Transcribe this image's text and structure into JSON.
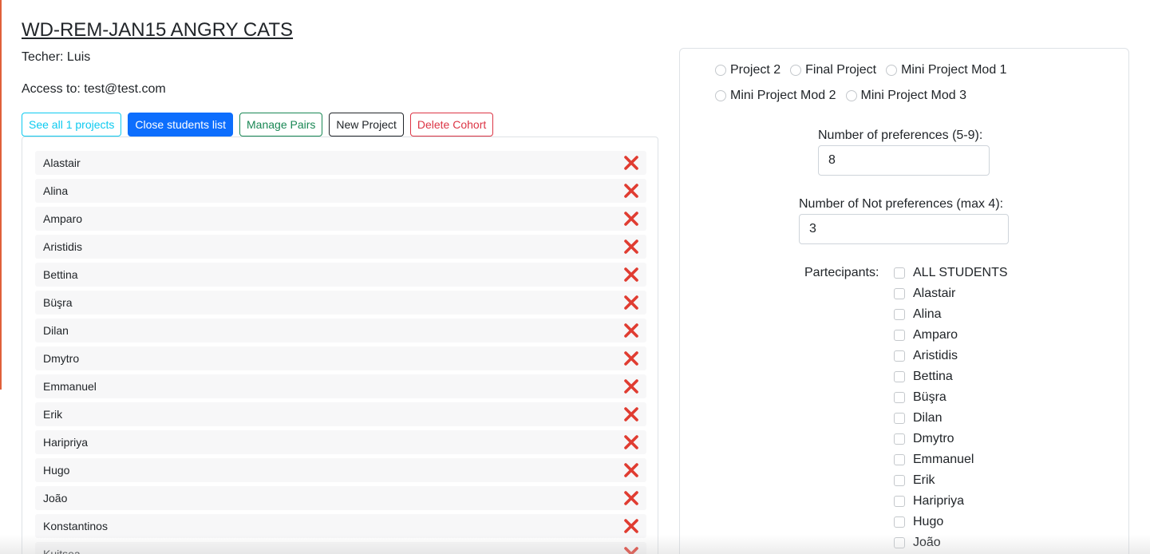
{
  "cohort": {
    "title": "WD-REM-JAN15 ANGRY CATS",
    "teacher": "Techer: Luis",
    "access": "Access to: test@test.com"
  },
  "toolbar": {
    "see_all": "See all 1 projects",
    "close_list": "Close students list",
    "manage_pairs": "Manage Pairs",
    "new_project": "New Project",
    "delete_cohort": "Delete Cohort"
  },
  "students": [
    "Alastair",
    "Alina",
    "Amparo",
    "Aristidis",
    "Bettina",
    "Büşra",
    "Dilan",
    "Dmytro",
    "Emmanuel",
    "Erik",
    "Haripriya",
    "Hugo",
    "João",
    "Konstantinos",
    "Kuitsea"
  ],
  "project_form": {
    "project_options": [
      "Project 2",
      "Final Project",
      "Mini Project Mod 1",
      "Mini Project Mod 2",
      "Mini Project Mod 3"
    ],
    "preferences_label": "Number of preferences (5-9):",
    "preferences_value": "8",
    "not_preferences_label": "Number of Not preferences (max 4):",
    "not_preferences_value": "3",
    "participants_label": "Partecipants:",
    "participants": [
      "ALL STUDENTS",
      "Alastair",
      "Alina",
      "Amparo",
      "Aristidis",
      "Bettina",
      "Büşra",
      "Dilan",
      "Dmytro",
      "Emmanuel",
      "Erik",
      "Haripriya",
      "Hugo",
      "João"
    ]
  },
  "colors": {
    "delete_icon": "#e03c31",
    "primary": "#0d6efd",
    "info": "#0dcaf0",
    "success": "#198754",
    "danger": "#dc3545",
    "edge_accent": "#e0603a"
  },
  "icons": {
    "delete": "x-mark-icon"
  }
}
